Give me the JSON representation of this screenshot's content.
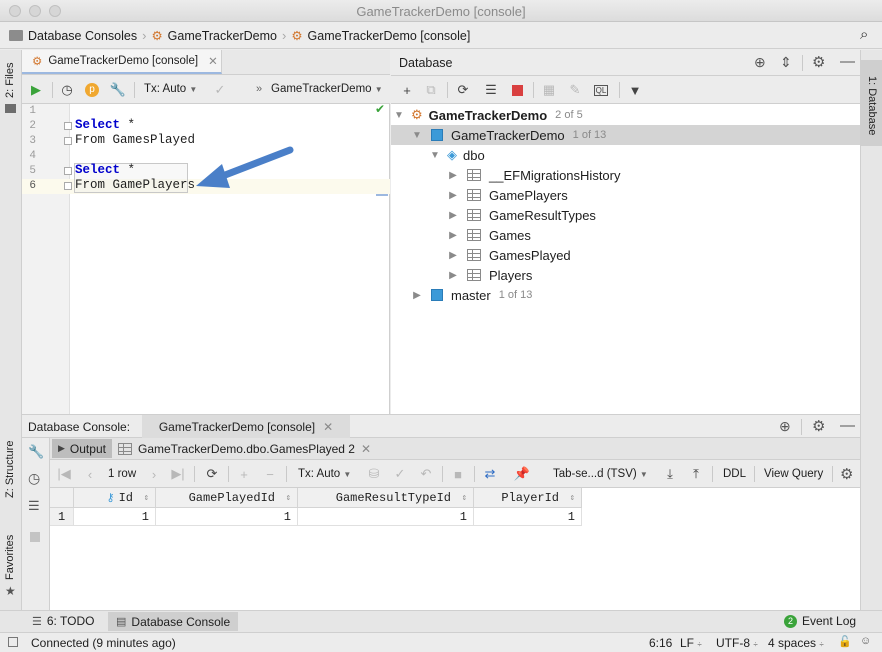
{
  "window": {
    "title": "GameTrackerDemo [console]"
  },
  "breadcrumb": [
    {
      "label": "Database Consoles",
      "icon": "folder-icon"
    },
    {
      "label": "GameTrackerDemo",
      "icon": "db-console-icon"
    },
    {
      "label": "GameTrackerDemo [console]",
      "icon": "db-console-icon"
    }
  ],
  "left_strip": {
    "files": "2: Files",
    "structure": "Z: Structure",
    "favorites": "Favorites"
  },
  "right_strip": {
    "database": "1: Database"
  },
  "editor": {
    "tab_label": "GameTrackerDemo [console]",
    "tx_label": "Tx: Auto",
    "datasource": "GameTrackerDemo",
    "lines": [
      {
        "n": "1",
        "text": ""
      },
      {
        "n": "2",
        "kw": "Select",
        "rest": " *"
      },
      {
        "n": "3",
        "text": "From GamesPlayed"
      },
      {
        "n": "4",
        "text": ""
      },
      {
        "n": "5",
        "kw": "Select",
        "rest": " *"
      },
      {
        "n": "6",
        "text": "From GamePlayers"
      }
    ]
  },
  "database_panel": {
    "title": "Database",
    "tree": {
      "root": {
        "label": "GameTrackerDemo",
        "meta": "2 of 5"
      },
      "db": {
        "label": "GameTrackerDemo",
        "meta": "1 of 13"
      },
      "schema": {
        "label": "dbo"
      },
      "tables": [
        "__EFMigrationsHistory",
        "GamePlayers",
        "GameResultTypes",
        "Games",
        "GamesPlayed",
        "Players"
      ],
      "master": {
        "label": "master",
        "meta": "1 of 13"
      }
    }
  },
  "console": {
    "header_label": "Database Console:",
    "tab_label": "GameTrackerDemo [console]",
    "subtabs": {
      "output": "Output",
      "result": "GameTrackerDemo.dbo.GamesPlayed 2"
    },
    "toolbar": {
      "rows": "1 row",
      "tx": "Tx: Auto",
      "format": "Tab-se...d (TSV)",
      "ddl": "DDL",
      "view_query": "View Query"
    },
    "grid": {
      "columns": [
        "Id",
        "GamePlayedId",
        "GameResultTypeId",
        "PlayerId"
      ],
      "rows": [
        {
          "n": "1",
          "cells": [
            "1",
            "1",
            "1",
            "1"
          ]
        }
      ]
    }
  },
  "toolwindows": {
    "todo": "6: TODO",
    "db_console": "Database Console",
    "event_log": "Event Log",
    "event_count": "2"
  },
  "status": {
    "connection": "Connected (9 minutes ago)",
    "position": "6:16",
    "line_sep": "LF",
    "encoding": "UTF-8",
    "indent": "4 spaces"
  }
}
